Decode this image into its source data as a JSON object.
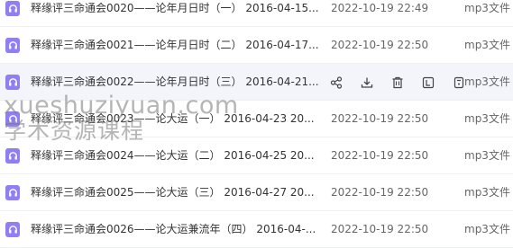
{
  "files": [
    {
      "name": "释缘评三命通会0020——论年月日时（一） 2016-04-15...",
      "date": "2022-10-19 22:49",
      "type": "mp3文件",
      "icon": "headphones-icon"
    },
    {
      "name": "释缘评三命通会0021——论年月日时（二） 2016-04-17...",
      "date": "2022-10-19 22:50",
      "type": "mp3文件",
      "icon": "headphones-icon"
    },
    {
      "name": "释缘评三命通会0022——论年月日时（三） 2016-04-21...",
      "date": "",
      "type": "mp3文件",
      "icon": "headphones-icon"
    },
    {
      "name": "释缘评三命通会0023——论大运（一） 2016-04-23 20...",
      "date": "2022-10-19 22:50",
      "type": "mp3文件",
      "icon": "headphones-icon"
    },
    {
      "name": "释缘评三命通会0024——论大运（二） 2016-04-25 20...",
      "date": "2022-10-19 22:50",
      "type": "mp3文件",
      "icon": "headphones-icon"
    },
    {
      "name": "释缘评三命通会0025——论大运（三） 2016-04-27 20...",
      "date": "2022-10-19 22:50",
      "type": "mp3文件",
      "icon": "headphones-icon"
    },
    {
      "name": "释缘评三命通会0026——论大运兼流年（四） 2016-04-...",
      "date": "2022-10-19 22:50",
      "type": "mp3文件",
      "icon": "headphones-icon"
    }
  ],
  "hover_actions": [
    "share-icon",
    "download-icon",
    "delete-icon",
    "copy-icon",
    "more-icon"
  ],
  "watermark": {
    "line1": "xueshuziyuan.com",
    "line2": "学术资源课程"
  },
  "colors": {
    "file_icon": "#8f7ef4",
    "hover_row": "#f3f5fb",
    "text": "#333333",
    "muted": "#666666"
  }
}
